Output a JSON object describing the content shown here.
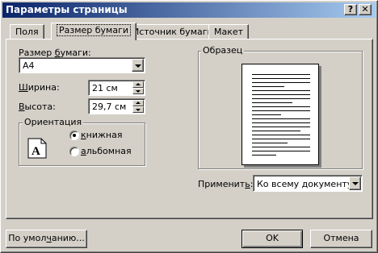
{
  "window": {
    "title": "Параметры страницы",
    "help_button": "?",
    "close_button": "✕"
  },
  "tabs": [
    {
      "label": "Поля",
      "active": false
    },
    {
      "label": "Размер бумаги",
      "active": true
    },
    {
      "label": "Источник бумаги",
      "active": false
    },
    {
      "label": "Макет",
      "active": false
    }
  ],
  "paper_size": {
    "label_pre": "Размер ",
    "label_mnemonic": "б",
    "label_post": "умаги:",
    "value": "A4"
  },
  "width": {
    "label_mnemonic": "Ш",
    "label_post": "ирина:",
    "value": "21 см"
  },
  "height": {
    "label_mnemonic": "В",
    "label_post": "ысота:",
    "value": "29,7 см"
  },
  "orientation": {
    "title": "Ориентация",
    "icon_letter": "A",
    "portrait": {
      "mnemonic": "к",
      "label_post": "нижная",
      "checked": true
    },
    "landscape": {
      "mnemonic": "а",
      "label_post": "льбомная",
      "checked": false
    }
  },
  "preview": {
    "title": "Образец"
  },
  "apply_to": {
    "label_pre": "Применит",
    "label_mnemonic": "ь",
    "label_post": ":",
    "value": "Ко всему документу"
  },
  "buttons": {
    "default_pre": "По умол",
    "default_mnemonic": "ч",
    "default_post": "анию...",
    "ok": "OK",
    "cancel": "Отмена"
  }
}
